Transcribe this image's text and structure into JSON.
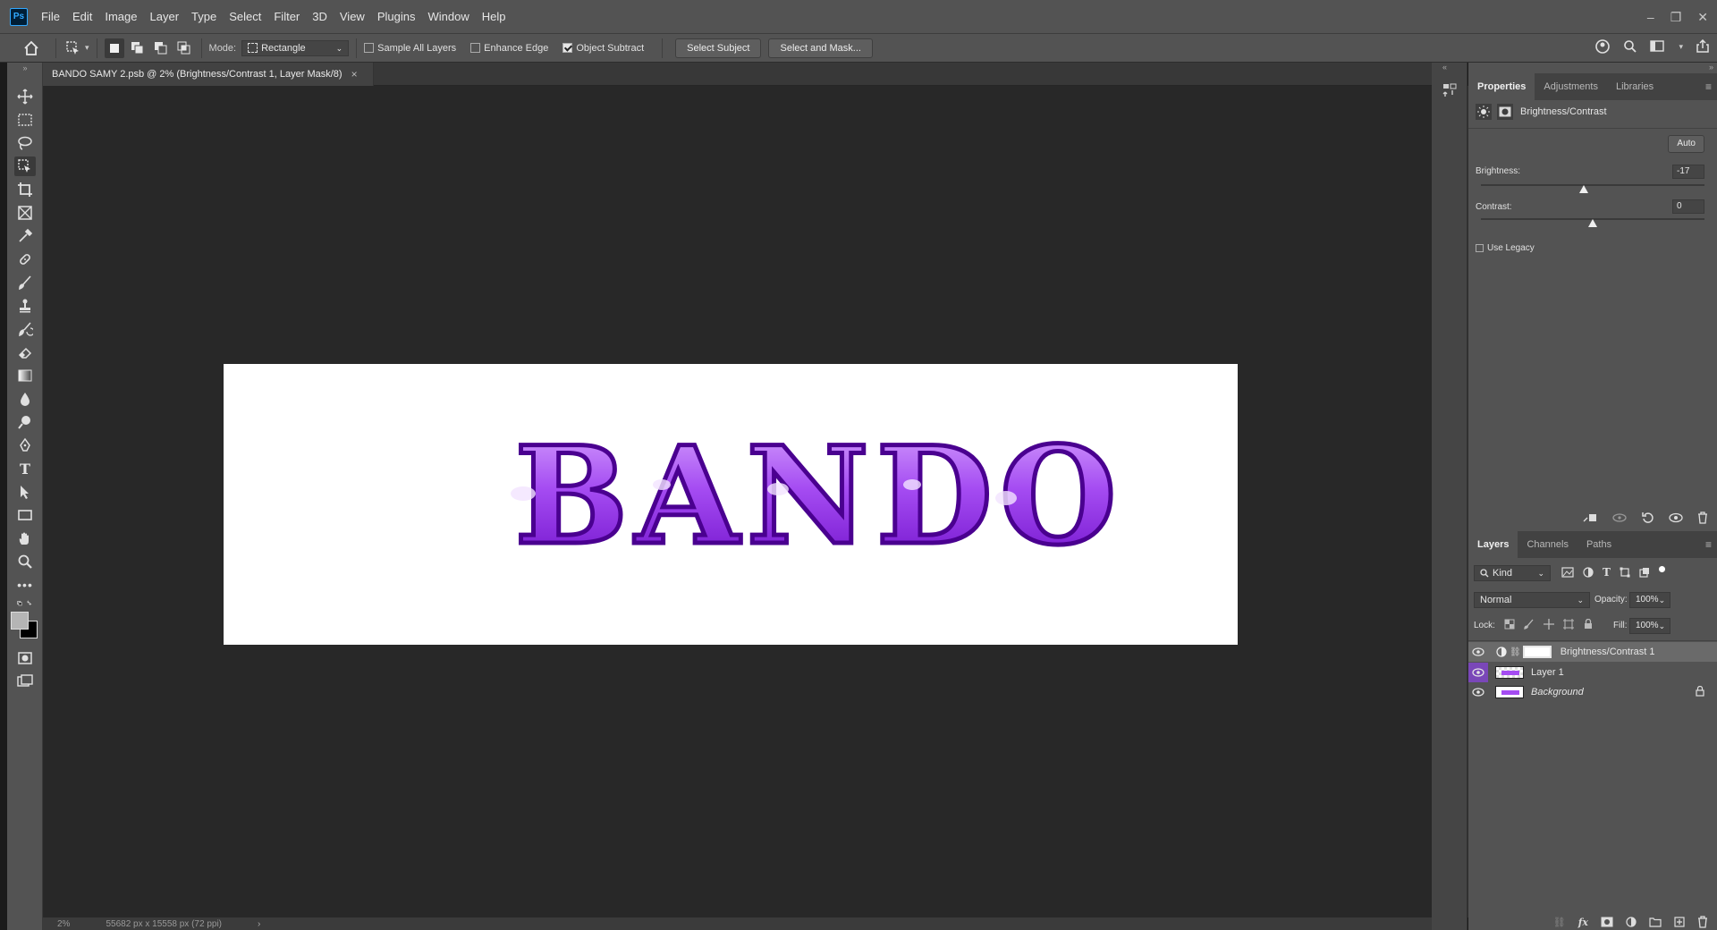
{
  "app": {
    "logo": "Ps"
  },
  "menu": [
    "File",
    "Edit",
    "Image",
    "Layer",
    "Type",
    "Select",
    "Filter",
    "3D",
    "View",
    "Plugins",
    "Window",
    "Help"
  ],
  "window_controls": {
    "minimize": "–",
    "restore": "❐",
    "close": "✕"
  },
  "options": {
    "mode_label": "Mode:",
    "mode_value": "Rectangle",
    "sample_all_layers": {
      "label": "Sample All Layers",
      "checked": false
    },
    "enhance_edge": {
      "label": "Enhance Edge",
      "checked": false
    },
    "object_subtract": {
      "label": "Object Subtract",
      "checked": true
    },
    "select_subject": "Select Subject",
    "select_and_mask": "Select and Mask..."
  },
  "document": {
    "tab_title": "BANDO SAMY 2.psb @ 2% (Brightness/Contrast 1, Layer Mask/8)",
    "tab_close": "×",
    "artwork_text": "BANDO",
    "zoom": "2%",
    "doc_info": "55682 px x 15558 px (72 ppi)"
  },
  "properties_panel": {
    "tabs": [
      "Properties",
      "Adjustments",
      "Libraries"
    ],
    "active_tab": "Properties",
    "adjustment_name": "Brightness/Contrast",
    "auto_button": "Auto",
    "brightness": {
      "label": "Brightness:",
      "value": "-17",
      "fraction": 0.46
    },
    "contrast": {
      "label": "Contrast:",
      "value": "0",
      "fraction": 0.5
    },
    "use_legacy": {
      "label": "Use Legacy",
      "checked": false
    }
  },
  "layers_panel": {
    "tabs": [
      "Layers",
      "Channels",
      "Paths"
    ],
    "active_tab": "Layers",
    "filter_kind": "Kind",
    "blend_mode": "Normal",
    "opacity_label": "Opacity:",
    "opacity_value": "100%",
    "lock_label": "Lock:",
    "fill_label": "Fill:",
    "fill_value": "100%",
    "layers": [
      {
        "name": "Brightness/Contrast 1",
        "type": "adjustment",
        "selected": true
      },
      {
        "name": "Layer 1",
        "type": "pixel",
        "selected": false
      },
      {
        "name": "Background",
        "type": "background",
        "selected": false,
        "locked": true
      }
    ]
  },
  "colors": {
    "accent_purple": "#9a3df0",
    "ps_blue": "#31a8ff",
    "panel_bg": "#535353",
    "canvas_bg": "#282828"
  }
}
